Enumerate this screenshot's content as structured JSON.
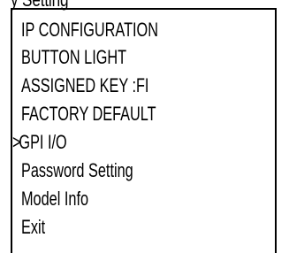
{
  "top_partial_text": "y Setting",
  "menu": {
    "items": [
      {
        "label": "IP CONFIGURATION",
        "selected": false
      },
      {
        "label": "BUTTON LIGHT",
        "selected": false
      },
      {
        "label": "ASSIGNED KEY :FI",
        "selected": false
      },
      {
        "label": "FACTORY DEFAULT",
        "selected": false
      },
      {
        "label": "GPI I/O",
        "selected": true
      },
      {
        "label": "Password Setting",
        "selected": false
      },
      {
        "label": "Model Info",
        "selected": false
      },
      {
        "label": "Exit",
        "selected": false
      }
    ],
    "cursor_symbol": ">"
  }
}
